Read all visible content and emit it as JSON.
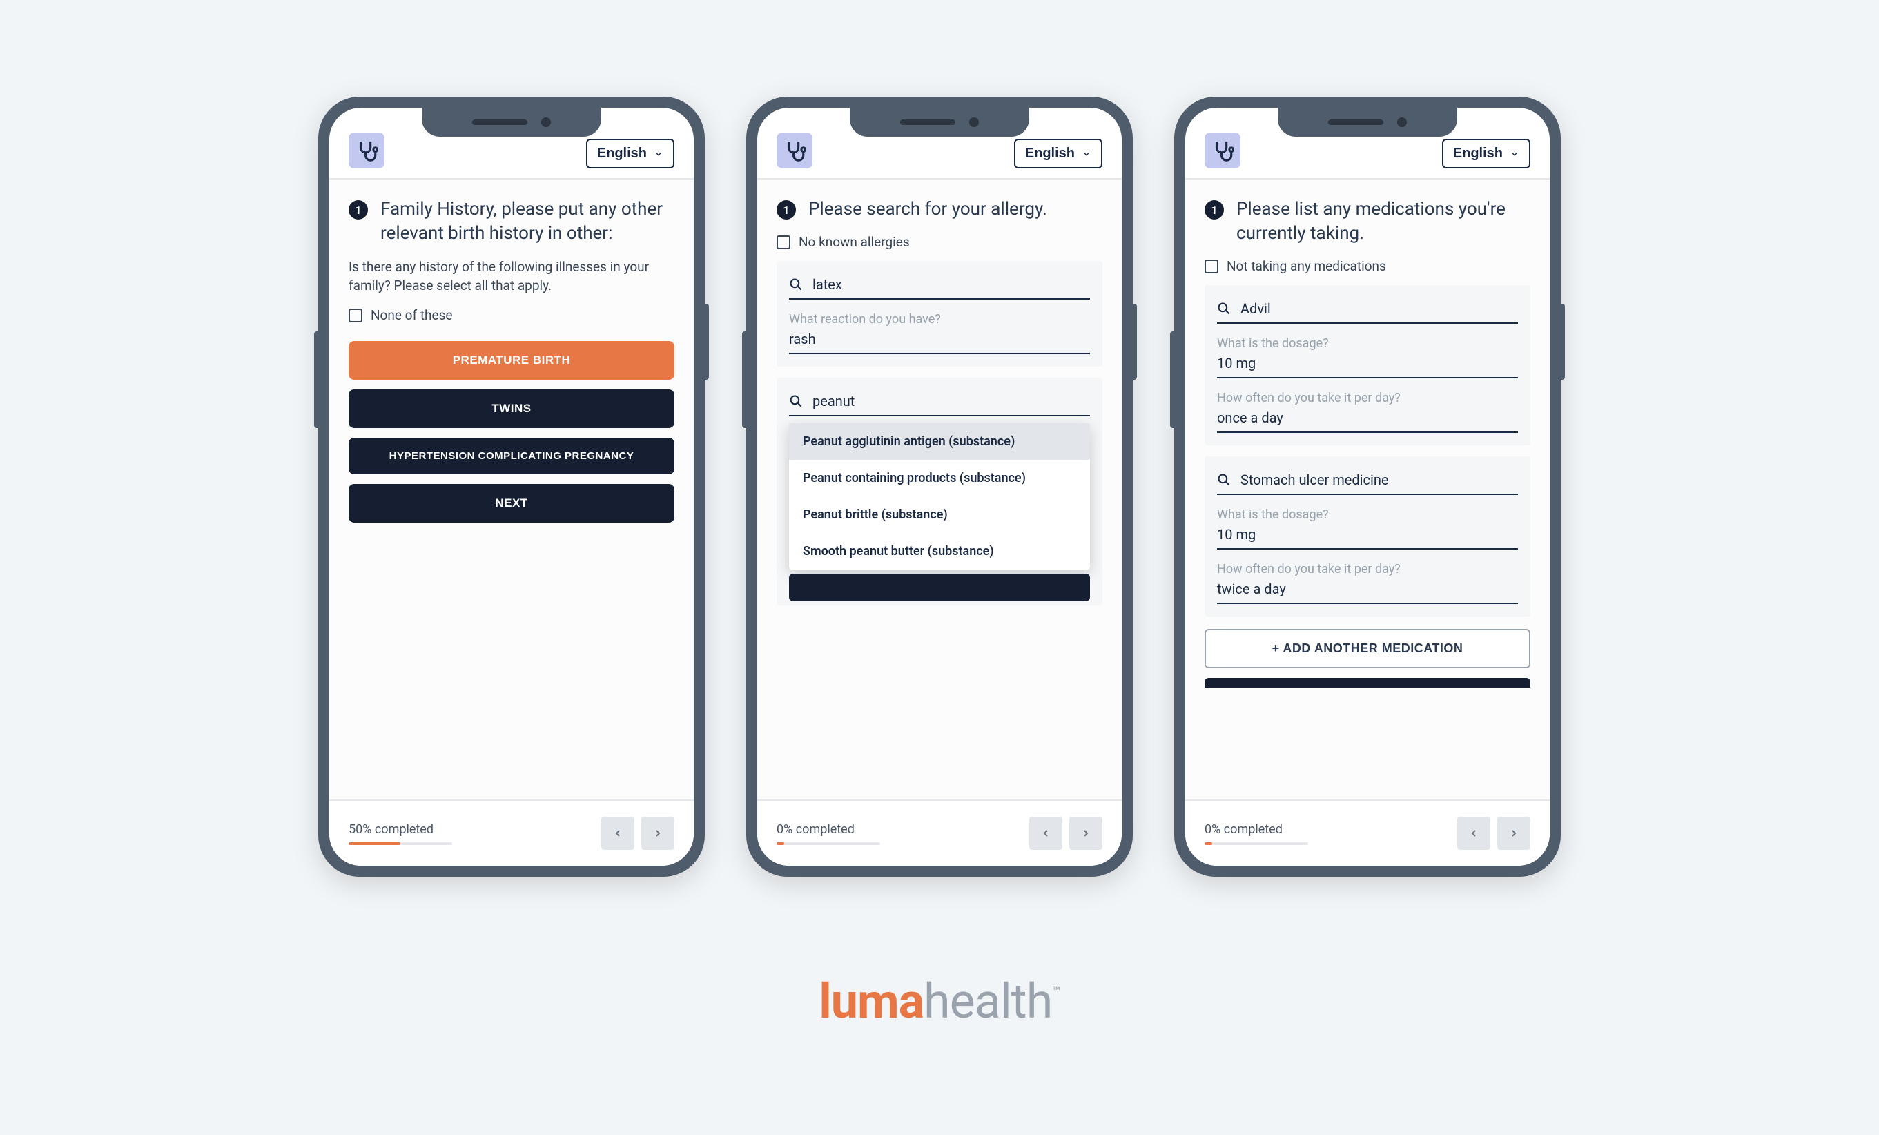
{
  "language_label": "English",
  "brand": {
    "part1": "luma",
    "part2": "health"
  },
  "phone1": {
    "q_number": "1",
    "title": "Family History, please put any other relevant birth history in other:",
    "subtext": "Is there any history of the following illnesses in your family? Please select all that apply.",
    "none_label": "None of these",
    "options": {
      "premature": "PREMATURE BIRTH",
      "twins": "TWINS",
      "hypertension": "HYPERTENSION COMPLICATING PREGNANCY",
      "next": "NEXT"
    },
    "progress_label": "50% completed",
    "progress_pct": 50
  },
  "phone2": {
    "q_number": "1",
    "title": "Please search for your allergy.",
    "none_label": "No known allergies",
    "allergy1": {
      "search": "latex",
      "reaction_label": "What reaction do you have?",
      "reaction_value": "rash"
    },
    "allergy2": {
      "search": "peanut",
      "suggestions": [
        "Peanut agglutinin antigen (substance)",
        "Peanut containing products (substance)",
        "Peanut brittle (substance)",
        "Smooth peanut butter (substance)"
      ]
    },
    "progress_label": "0% completed",
    "progress_pct": 7
  },
  "phone3": {
    "q_number": "1",
    "title": "Please list any medications you're currently taking.",
    "none_label": "Not taking any medications",
    "med1": {
      "search": "Advil",
      "dosage_label": "What is the dosage?",
      "dosage_value": "10 mg",
      "freq_label": "How often do you take it per day?",
      "freq_value": "once a day"
    },
    "med2": {
      "search": "Stomach ulcer medicine",
      "dosage_label": "What is the dosage?",
      "dosage_value": "10 mg",
      "freq_label": "How often do you take it per day?",
      "freq_value": "twice a day"
    },
    "add_label": "+  ADD ANOTHER MEDICATION",
    "progress_label": "0% completed",
    "progress_pct": 7
  }
}
